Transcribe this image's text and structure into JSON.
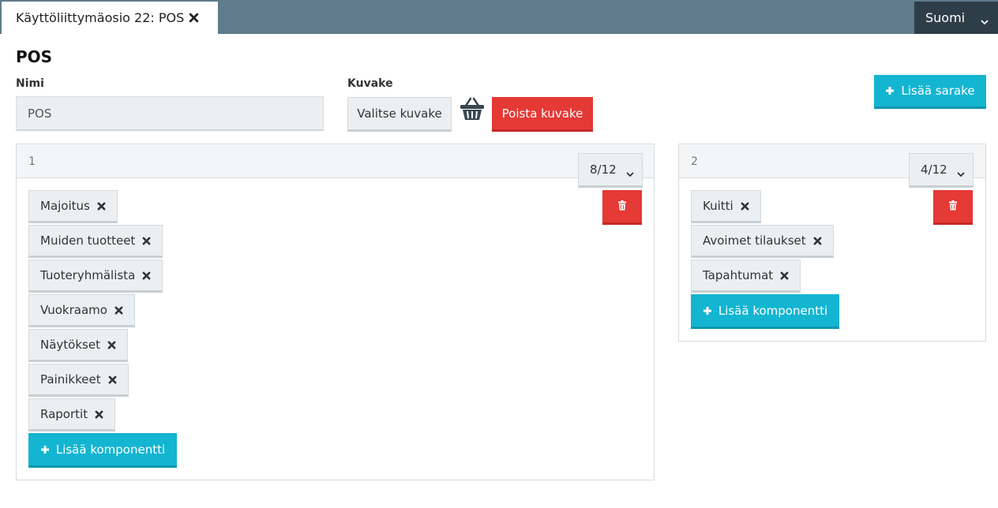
{
  "tab": {
    "title": "Käyttöliittymäosio 22: POS"
  },
  "language": {
    "selected": "Suomi"
  },
  "page": {
    "title": "POS"
  },
  "form": {
    "name_label": "Nimi",
    "name_value": "POS",
    "icon_label": "Kuvake",
    "choose_icon_label": "Valitse kuvake",
    "remove_icon_label": "Poista kuvake",
    "icon": "basket-icon"
  },
  "actions": {
    "add_column_label": "Lisää sarake"
  },
  "columns": [
    {
      "number": "1",
      "width": "8/12",
      "components": [
        "Majoitus",
        "Muiden tuotteet",
        "Tuoteryhmälista",
        "Vuokraamo",
        "Näytökset",
        "Painikkeet",
        "Raportit"
      ],
      "add_component_label": "Lisää komponentti"
    },
    {
      "number": "2",
      "width": "4/12",
      "components": [
        "Kuitti",
        "Avoimet tilaukset",
        "Tapahtumat"
      ],
      "add_component_label": "Lisää komponentti"
    }
  ],
  "colors": {
    "topbar": "#5f7b8c",
    "danger": "#e53935",
    "accent": "#13b5d1"
  }
}
